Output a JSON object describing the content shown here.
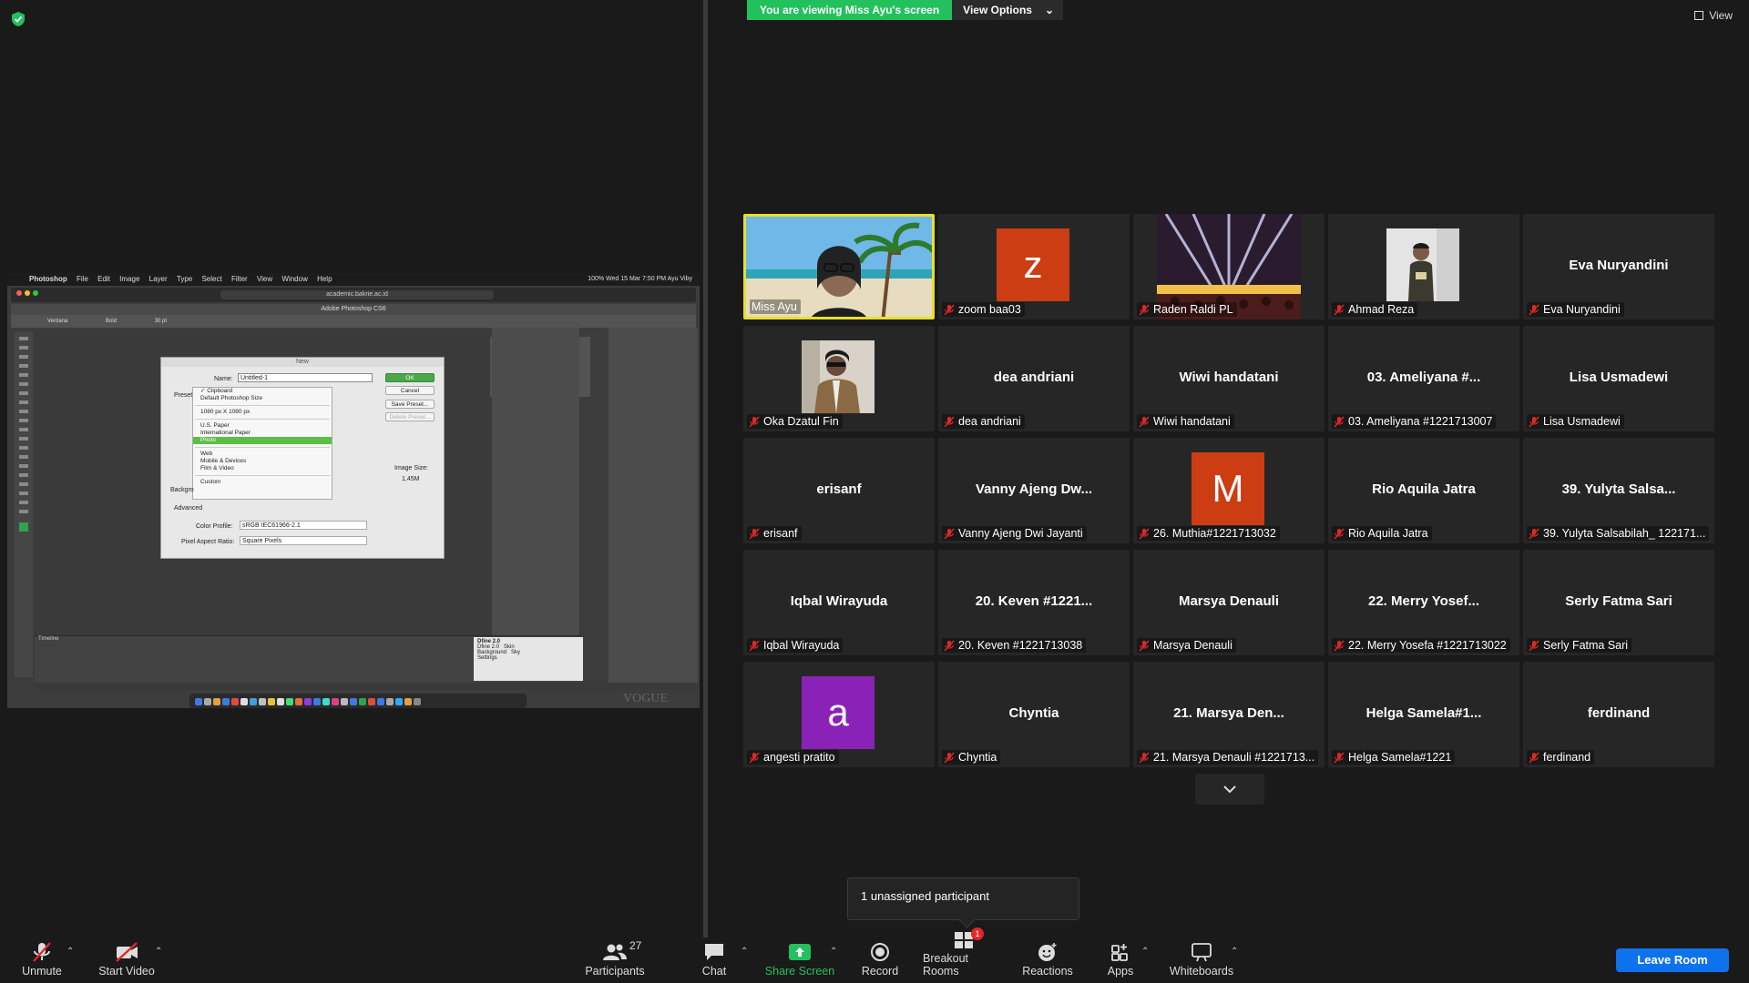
{
  "banner": {
    "viewing_text": "You are viewing Miss Ayu's screen",
    "view_options_label": "View Options",
    "top_right_view_label": "View"
  },
  "shared_screen": {
    "mac_menu": [
      "Photoshop",
      "File",
      "Edit",
      "Image",
      "Layer",
      "Type",
      "Select",
      "Filter",
      "View",
      "Window",
      "Help"
    ],
    "mac_status": "100%  Wed 15 Mar 7:50 PM  Ayu Viby",
    "url": "academic.bakrie.ac.id",
    "ps_title": "Adobe Photoshop CS6",
    "ps_font": "Verdana",
    "ps_style": "Bold",
    "ps_size": "30 pt",
    "dialog": {
      "title": "New",
      "name_label": "Name:",
      "name_value": "Untitled-1",
      "ok": "OK",
      "cancel": "Cancel",
      "save_preset": "Save Preset...",
      "delete_preset": "Delete Preset...",
      "preset_label": "Preset",
      "preset_items": [
        "✓ Clipboard",
        "Default Photoshop Size",
        "1080 px X 1080 px",
        "U.S. Paper",
        "International Paper",
        "Photo",
        "Web",
        "Mobile & Devices",
        "Film & Video",
        "Custom"
      ],
      "background_label": "Backgro",
      "advanced_label": "Advanced",
      "color_profile_label": "Color Profile:",
      "color_profile_value": "sRGB IEC61966-2.1",
      "pixel_aspect_label": "Pixel Aspect Ratio:",
      "pixel_aspect_value": "Square Pixels",
      "image_size_label": "Image Size:",
      "image_size_value": "1,45M"
    },
    "timeline_label": "Timeline",
    "dfine": {
      "title": "Dfine 2.0",
      "row1": "Dfine 2.0",
      "row1b": "Skin",
      "row2": "Background",
      "row2b": "Sky",
      "row3": "Settings"
    },
    "vogue": "VOGUE"
  },
  "participants_tiles": [
    {
      "label": "Miss Ayu",
      "center_name": "",
      "muted": false,
      "active": true,
      "kind": "photo-ayu"
    },
    {
      "label": "zoom baa03",
      "center_name": "",
      "muted": true,
      "kind": "letter",
      "letter": "z",
      "color": "#cc3d13"
    },
    {
      "label": "Raden Raldi PL",
      "center_name": "",
      "muted": true,
      "kind": "photo-concert"
    },
    {
      "label": "Ahmad Reza",
      "center_name": "",
      "muted": true,
      "kind": "photo-reza"
    },
    {
      "label": "Eva Nuryandini",
      "center_name": "Eva Nuryandini",
      "muted": true,
      "kind": "name"
    },
    {
      "label": "Oka Dzatul Fin",
      "center_name": "",
      "muted": true,
      "kind": "photo-oka"
    },
    {
      "label": "dea andriani",
      "center_name": "dea andriani",
      "muted": true,
      "kind": "name"
    },
    {
      "label": "Wiwi handatani",
      "center_name": "Wiwi handatani",
      "muted": true,
      "kind": "name"
    },
    {
      "label": "03. Ameliyana #1221713007",
      "center_name": "03. Ameliyana #...",
      "muted": true,
      "kind": "name"
    },
    {
      "label": "Lisa Usmadewi",
      "center_name": "Lisa Usmadewi",
      "muted": true,
      "kind": "name"
    },
    {
      "label": "erisanf",
      "center_name": "erisanf",
      "muted": true,
      "kind": "name"
    },
    {
      "label": "Vanny Ajeng Dwi Jayanti",
      "center_name": "Vanny Ajeng Dw...",
      "muted": true,
      "kind": "name"
    },
    {
      "label": "26. Muthia#1221713032",
      "center_name": "",
      "muted": true,
      "kind": "letter",
      "letter": "M",
      "color": "#cc3d13"
    },
    {
      "label": "Rio Aquila Jatra",
      "center_name": "Rio Aquila Jatra",
      "muted": true,
      "kind": "name"
    },
    {
      "label": "39. Yulyta Salsabilah_ 122171...",
      "center_name": "39. Yulyta Salsa...",
      "muted": true,
      "kind": "name"
    },
    {
      "label": "Iqbal Wirayuda",
      "center_name": "Iqbal Wirayuda",
      "muted": true,
      "kind": "name"
    },
    {
      "label": "20. Keven #1221713038",
      "center_name": "20. Keven #1221...",
      "muted": true,
      "kind": "name"
    },
    {
      "label": "Marsya Denauli",
      "center_name": "Marsya Denauli",
      "muted": true,
      "kind": "name"
    },
    {
      "label": "22. Merry Yosefa #1221713022",
      "center_name": "22. Merry Yosef...",
      "muted": true,
      "kind": "name"
    },
    {
      "label": "Serly Fatma Sari",
      "center_name": "Serly Fatma Sari",
      "muted": true,
      "kind": "name"
    },
    {
      "label": "angesti pratito",
      "center_name": "",
      "muted": true,
      "kind": "letter",
      "letter": "a",
      "color": "#8a22b8"
    },
    {
      "label": "Chyntia",
      "center_name": "Chyntia",
      "muted": true,
      "kind": "name"
    },
    {
      "label": "21. Marsya Denauli #1221713...",
      "center_name": "21. Marsya Den...",
      "muted": true,
      "kind": "name"
    },
    {
      "label": "Helga Samela#1221",
      "center_name": "Helga Samela#1...",
      "muted": true,
      "kind": "name"
    },
    {
      "label": "ferdinand",
      "center_name": "ferdinand",
      "muted": true,
      "kind": "name"
    }
  ],
  "toast": {
    "text": "1 unassigned participant"
  },
  "toolbar": {
    "unmute": "Unmute",
    "start_video": "Start Video",
    "participants": "Participants",
    "participants_count": "27",
    "chat": "Chat",
    "share_screen": "Share Screen",
    "record": "Record",
    "breakout_rooms": "Breakout Rooms",
    "breakout_badge": "1",
    "reactions": "Reactions",
    "apps": "Apps",
    "whiteboards": "Whiteboards",
    "leave_room": "Leave Room"
  },
  "colors": {
    "accent_green": "#23c15d",
    "leave_blue": "#0e72ed",
    "active_speaker": "#e8e02a",
    "muted_red": "#e02828"
  }
}
